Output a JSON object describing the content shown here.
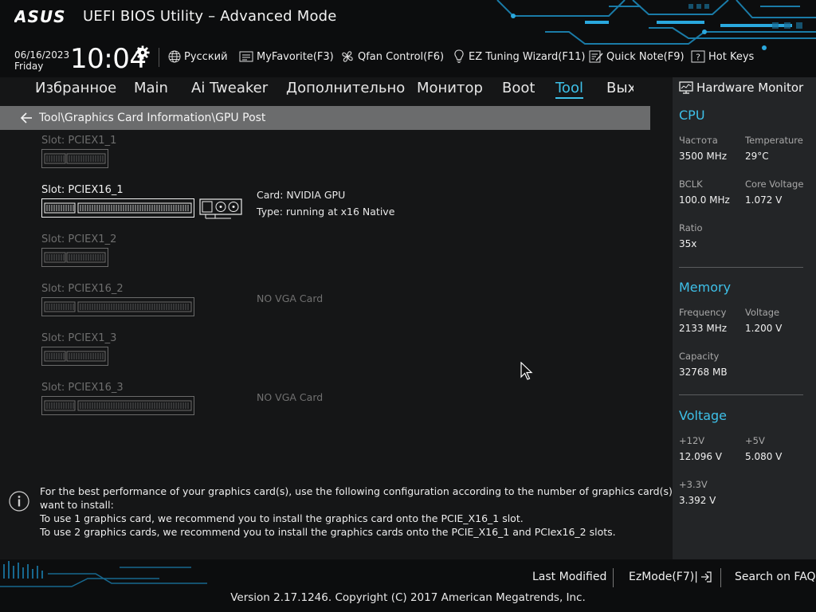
{
  "header": {
    "brand": "ASUS",
    "title": "UEFI BIOS Utility – Advanced Mode",
    "date": "06/16/2023",
    "day": "Friday",
    "time": "10:04",
    "toolbar": {
      "language": "Русский",
      "myfavorite": "MyFavorite(F3)",
      "qfan": "Qfan Control(F6)",
      "ez_tuning": "EZ Tuning Wizard(F11)",
      "quick_note": "Quick Note(F9)",
      "hot_keys": "Hot Keys"
    }
  },
  "nav": {
    "tabs": [
      "Избранное",
      "Main",
      "Ai Tweaker",
      "Дополнительно",
      "Монитор",
      "Boot",
      "Tool",
      "Выход"
    ],
    "active_tab": "Tool"
  },
  "breadcrumb": "Tool\\Graphics Card Information\\GPU Post",
  "slots": [
    {
      "label": "Slot: PCIEX1_1",
      "type": "x1",
      "active": false,
      "info": []
    },
    {
      "label": "Slot: PCIEX16_1",
      "type": "x16",
      "active": true,
      "info": [
        "Card: NVIDIA GPU",
        "Type: running at x16 Native"
      ]
    },
    {
      "label": "Slot: PCIEX1_2",
      "type": "x1",
      "active": false,
      "info": []
    },
    {
      "label": "Slot: PCIEX16_2",
      "type": "x16",
      "active": false,
      "info": [
        "NO VGA Card"
      ]
    },
    {
      "label": "Slot: PCIEX1_3",
      "type": "x1",
      "active": false,
      "info": []
    },
    {
      "label": "Slot: PCIEX16_3",
      "type": "x16",
      "active": false,
      "info": [
        "NO VGA Card"
      ]
    }
  ],
  "info_panel": {
    "lines": [
      "For the best performance of your graphics card(s), use the following configuration according to the number of graphics card(s) you",
      "want to install:",
      "To use 1 graphics card, we recommend you to install  the graphics card onto the PCIE_X16_1 slot.",
      "To use 2 graphics cards, we recommend you to install the graphics cards onto the PCIE_X16_1 and PCIex16_2 slots."
    ]
  },
  "hw_monitor": {
    "title": "Hardware Monitor",
    "cpu": {
      "heading": "CPU",
      "freq_label": "Частота",
      "freq_value": "3500 MHz",
      "temp_label": "Temperature",
      "temp_value": "29°C",
      "bclk_label": "BCLK",
      "bclk_value": "100.0 MHz",
      "vcore_label": "Core Voltage",
      "vcore_value": "1.072 V",
      "ratio_label": "Ratio",
      "ratio_value": "35x"
    },
    "memory": {
      "heading": "Memory",
      "freq_label": "Frequency",
      "freq_value": "2133 MHz",
      "volt_label": "Voltage",
      "volt_value": "1.200 V",
      "cap_label": "Capacity",
      "cap_value": "32768 MB"
    },
    "voltage": {
      "heading": "Voltage",
      "v12_label": "+12V",
      "v12_value": "12.096 V",
      "v5_label": "+5V",
      "v5_value": "5.080 V",
      "v33_label": "+3.3V",
      "v33_value": "3.392 V"
    }
  },
  "footer": {
    "last_modified": "Last Modified",
    "ezmode": "EzMode(F7)|",
    "faq": "Search on FAQ",
    "copyright": "Version 2.17.1246. Copyright (C) 2017 American Megatrends, Inc."
  },
  "colors": {
    "accent": "#3ec0e8",
    "background": "#151617",
    "panel": "#232527",
    "breadcrumb_bar": "#6b6c6d"
  }
}
